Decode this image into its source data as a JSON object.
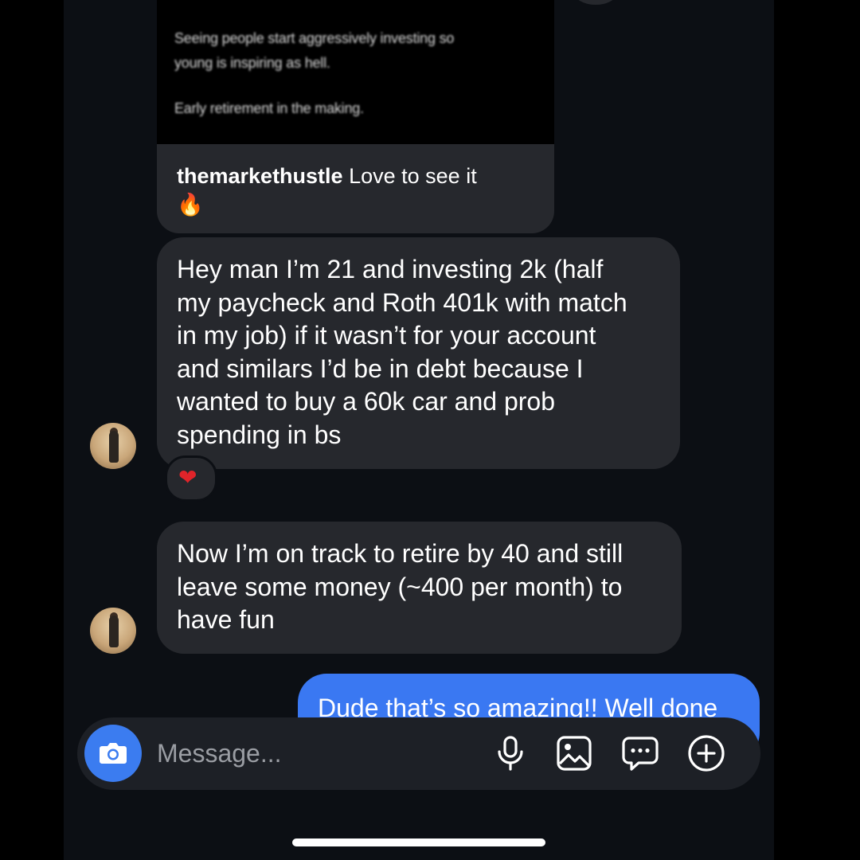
{
  "shared_post": {
    "preview_lines": [
      "Seeing people start aggressively investing so",
      "young is inspiring as hell.",
      "Early retirement in the making."
    ],
    "caption_username": "themarkethustle",
    "caption_text": "Love to see it",
    "caption_emoji": "🔥"
  },
  "messages": [
    {
      "sender": "other",
      "text_lines": [
        "Hey man I’m 21 and investing 2k (half",
        "my paycheck and Roth 401k with match",
        "in my job) if it wasn’t for your account",
        "and similars I’d be in debt because I",
        "wanted to buy a 60k car and prob",
        "spending in bs"
      ],
      "reaction": "❤"
    },
    {
      "sender": "other",
      "text_lines": [
        "Now I’m on track to retire by 40 and still",
        "leave some money (~400 per month) to",
        "have fun"
      ]
    },
    {
      "sender": "me",
      "text": "Dude that’s so amazing!! Well done"
    }
  ],
  "composer": {
    "placeholder": "Message...",
    "icons": [
      "camera-icon",
      "microphone-icon",
      "gallery-icon",
      "sticker-chat-icon",
      "add-icon"
    ]
  },
  "colors": {
    "background": "#0c0f14",
    "incoming_bubble": "#26282d",
    "outgoing_bubble": "#3a78f2",
    "camera_button": "#3b7cf0"
  }
}
